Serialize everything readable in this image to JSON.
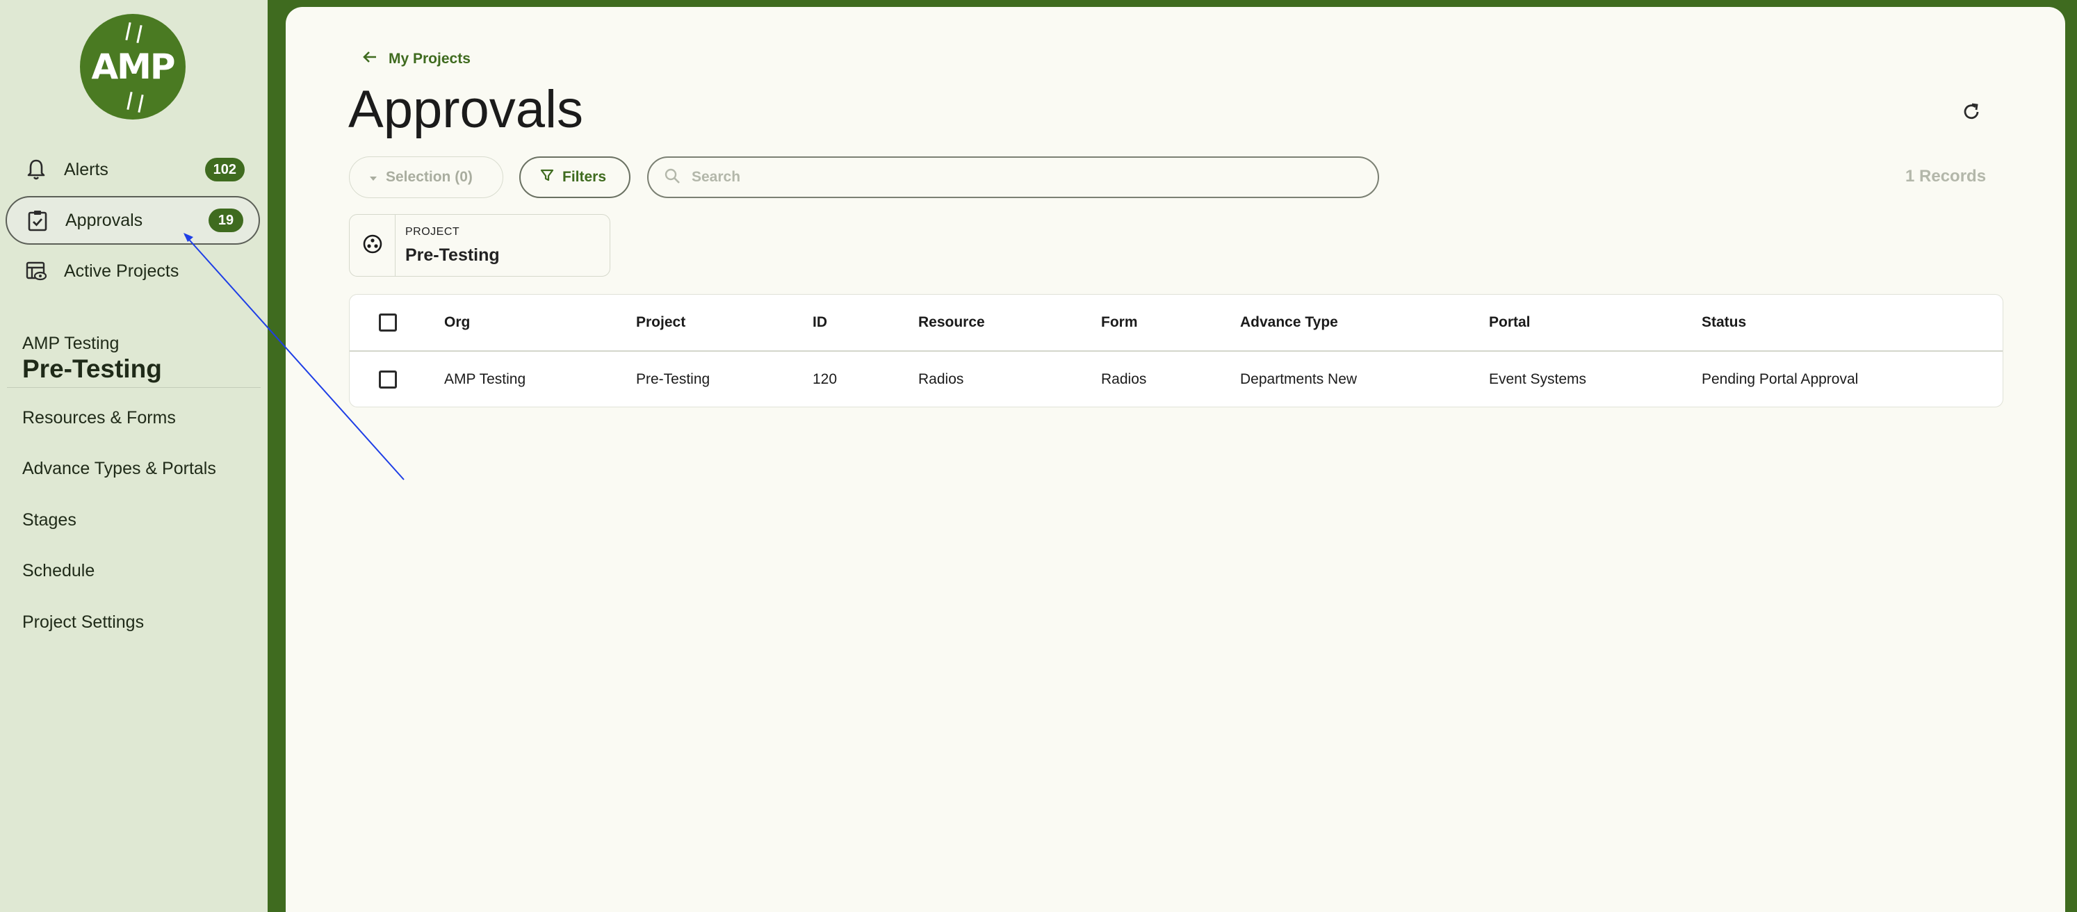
{
  "sidebar": {
    "logo_text": "AMP",
    "nav": [
      {
        "label": "Alerts",
        "badge": "102"
      },
      {
        "label": "Approvals",
        "badge": "19"
      },
      {
        "label": "Active Projects"
      }
    ],
    "project": {
      "org": "AMP Testing",
      "name": "Pre-Testing"
    },
    "project_nav": [
      "Resources & Forms",
      "Advance Types & Portals",
      "Stages",
      "Schedule",
      "Project Settings"
    ]
  },
  "header": {
    "back_label": "My Projects",
    "title": "Approvals"
  },
  "toolbar": {
    "selection_label": "Selection (0)",
    "filters_label": "Filters",
    "search_placeholder": "Search",
    "records_label": "1 Records"
  },
  "filter_chip": {
    "label": "PROJECT",
    "value": "Pre-Testing"
  },
  "table": {
    "columns": [
      "Org",
      "Project",
      "ID",
      "Resource",
      "Form",
      "Advance Type",
      "Portal",
      "Status"
    ],
    "rows": [
      [
        "AMP Testing",
        "Pre-Testing",
        "120",
        "Radios",
        "Radios",
        "Departments New",
        "Event Systems",
        "Pending Portal Approval"
      ]
    ]
  },
  "colors": {
    "brand_green": "#3f6b1f",
    "sidebar_bg": "#dfe8d3",
    "main_bg": "#fafaf3"
  }
}
